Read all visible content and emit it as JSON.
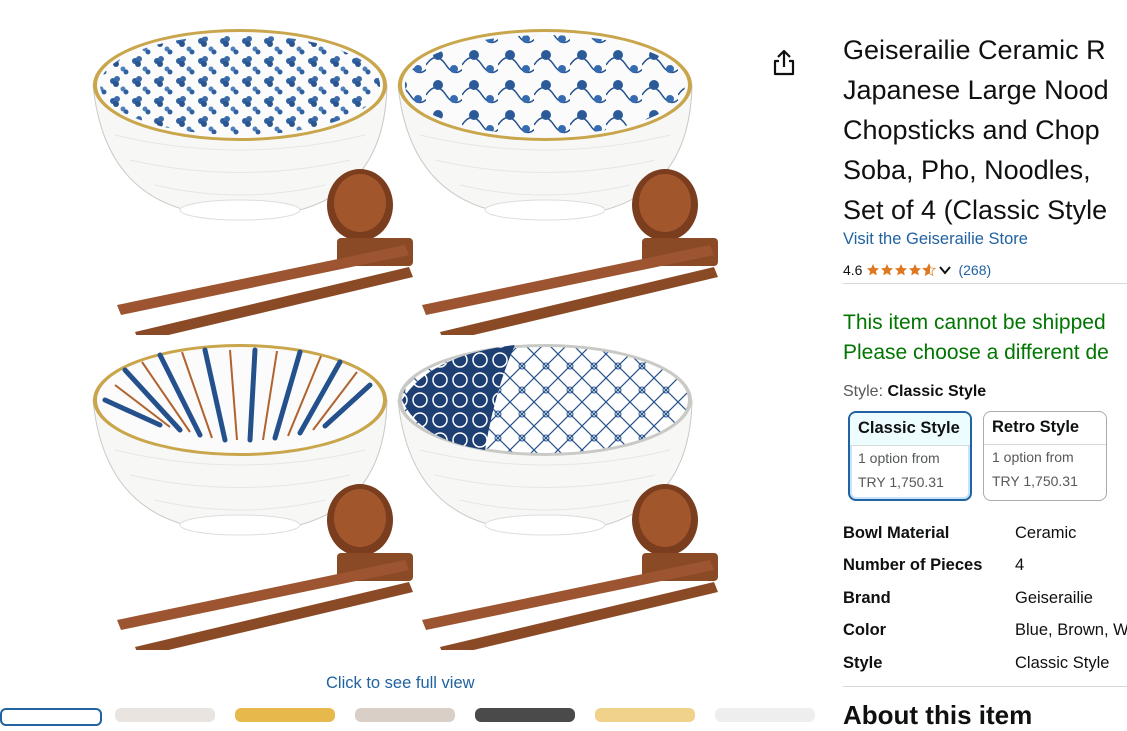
{
  "product": {
    "title_lines": [
      "Geiserailie Ceramic R",
      "Japanese Large Nood",
      "Chopsticks and Chop",
      "Soba, Pho, Noodles,",
      "Set of 4 (Classic Style"
    ],
    "store_link": "Visit the Geiserailie Store",
    "rating": "4.6",
    "rating_count": "(268)",
    "stars_filled_fraction": 0.92
  },
  "image": {
    "click_full_view": "Click to see full view"
  },
  "shipping": {
    "line1": "This item cannot be shipped",
    "line2": "Please choose a different de"
  },
  "style": {
    "label": "Style: ",
    "selected": "Classic Style",
    "options": [
      {
        "name": "Classic Style",
        "option_text": "1 option from",
        "price": "TRY 1,750.31"
      },
      {
        "name": "Retro Style",
        "option_text": "1 option from",
        "price": "TRY 1,750.31"
      }
    ]
  },
  "specs": [
    {
      "key": "Bowl Material",
      "value": "Ceramic"
    },
    {
      "key": "Number of Pieces",
      "value": "4"
    },
    {
      "key": "Brand",
      "value": "Geiserailie"
    },
    {
      "key": "Color",
      "value": "Blue, Brown, W"
    },
    {
      "key": "Style",
      "value": "Classic Style"
    }
  ],
  "about": {
    "heading": "About this item"
  },
  "colors": {
    "link": "#2162a1",
    "ship_green": "#007600",
    "star": "#de7921",
    "bowl_blue": "#24508c",
    "wood": "#8b4a26"
  },
  "icons": [
    "share-icon",
    "star-icon",
    "chevron-down-icon"
  ]
}
